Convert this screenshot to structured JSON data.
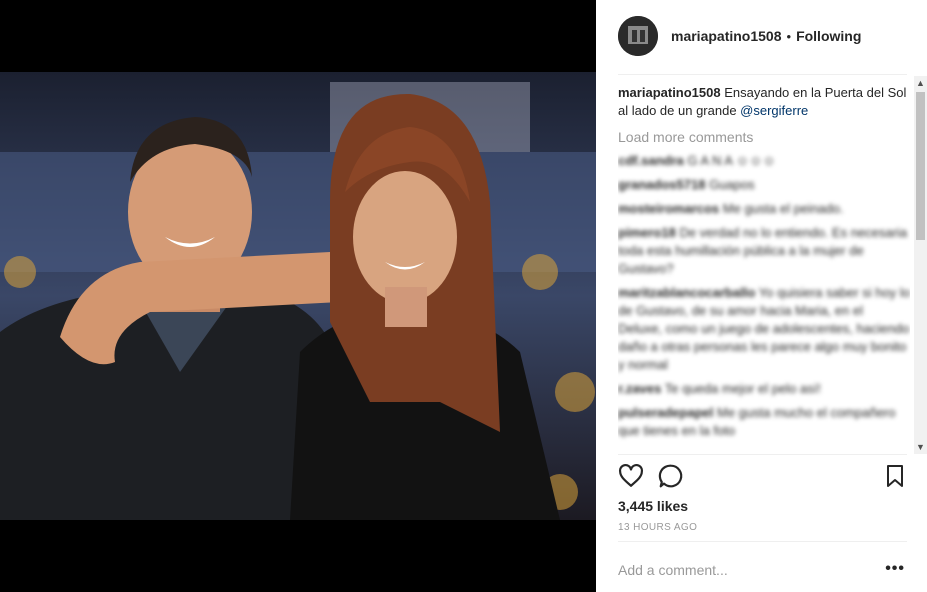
{
  "post": {
    "username": "mariapatino1508",
    "separator": "•",
    "follow_status": "Following",
    "caption_user": "mariapatino1508",
    "caption_text": "Ensayando en la Puerta del Sol al lado de un grande",
    "caption_mention": "@sergiferre",
    "load_more": "Load more comments",
    "likes": "3,445 likes",
    "timestamp": "13 HOURS AGO",
    "add_comment_placeholder": "Add a comment...",
    "more_options": "•••"
  },
  "comments": [
    {
      "user": "cdf.sandra",
      "text": "G A N A ☺☺☺"
    },
    {
      "user": "granados5718",
      "text": "Guapos"
    },
    {
      "user": "mosteiromarcos",
      "text": "Me gusta el peinado."
    },
    {
      "user": "pimero18",
      "text": "De verdad no lo entiendo. Es necesaria toda esta humillación pública a la mujer de Gustavo?"
    },
    {
      "user": "maritzablancocarballo",
      "text": "Yo quisiera saber si hoy lo de Gustavo, de su amor hacia Maria, en el Deluxe, como un juego de adolescentes, haciendo daño a otras personas les parece algo muy bonito y normal"
    },
    {
      "user": "r.zaves",
      "text": "Te queda mejor el pelo así!"
    },
    {
      "user": "pulseradepapel",
      "text": "Me gusta mucho el compañero que tienes en la foto"
    }
  ],
  "icons": {
    "like": "heart-icon",
    "comment": "comment-bubble-icon",
    "save": "bookmark-icon"
  },
  "colors": {
    "link": "#003569",
    "muted": "#999999",
    "text": "#262626"
  }
}
